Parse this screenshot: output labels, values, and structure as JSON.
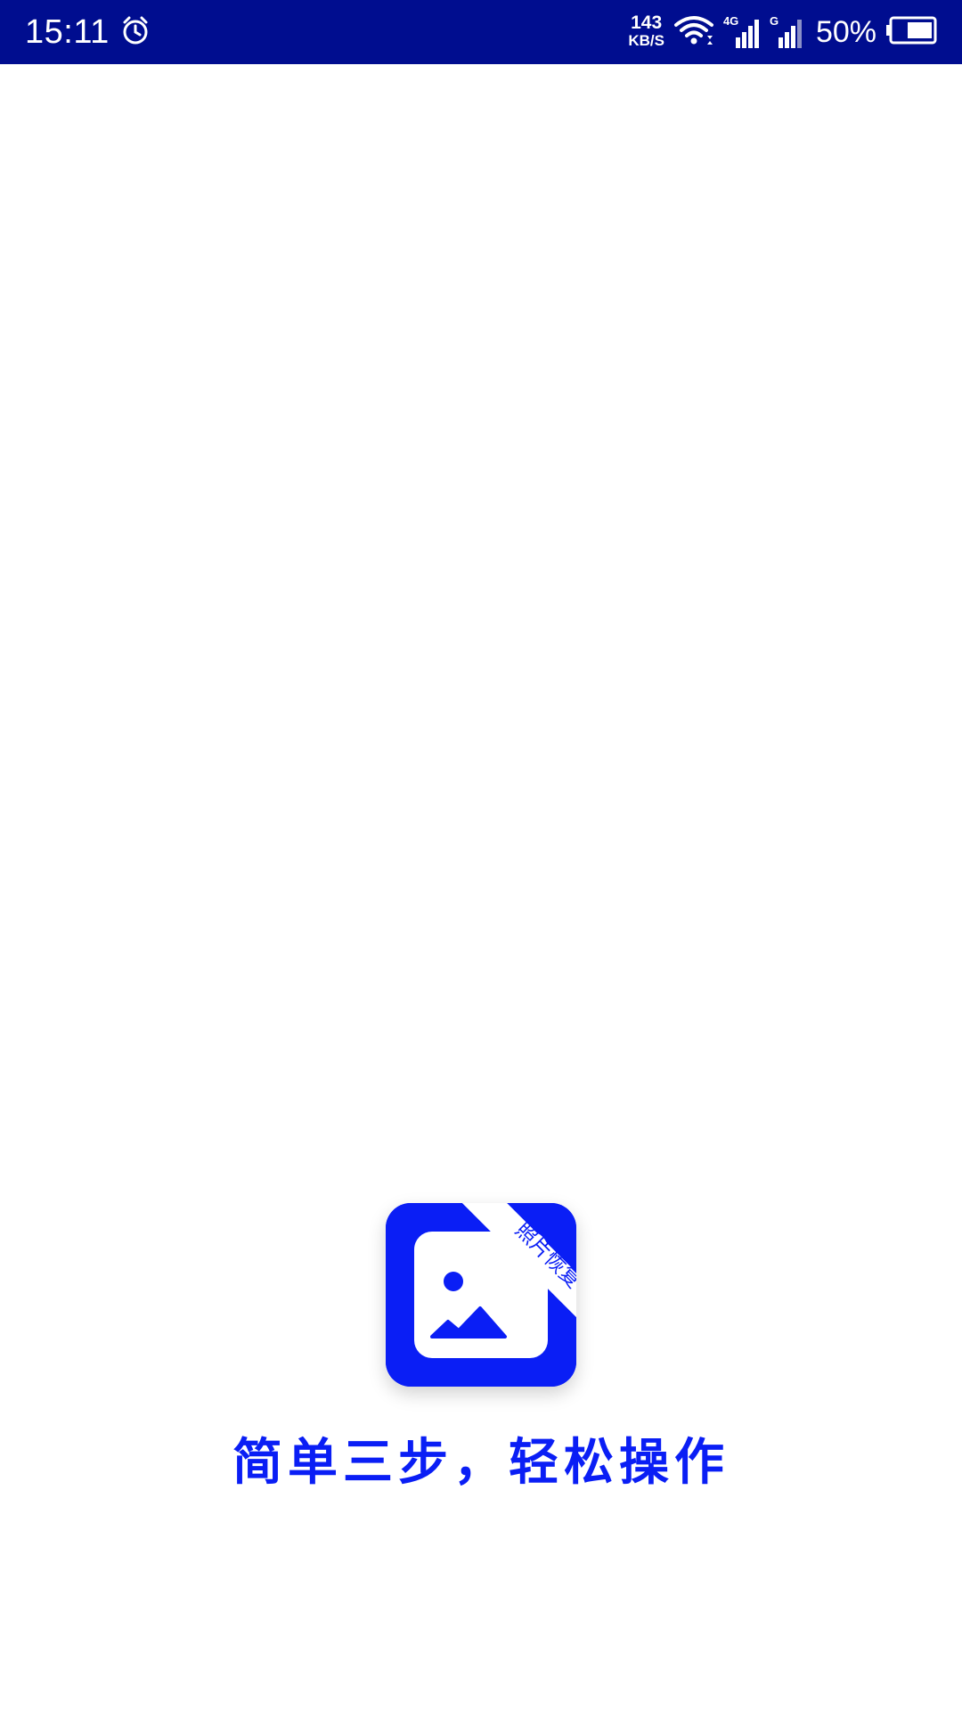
{
  "status_bar": {
    "time": "15:11",
    "net_speed_value": "143",
    "net_speed_unit": "KB/S",
    "sim1_label": "4G",
    "sim2_label": "G",
    "battery_percent": "50%",
    "background_color": "#000d8f",
    "icons": [
      "alarm-icon",
      "wifi-icon",
      "signal-icon",
      "signal-icon",
      "battery-icon"
    ]
  },
  "splash": {
    "logo_ribbon_text": "照片恢复",
    "slogan": "简单三步，轻松操作",
    "brand_color": "#0a1ef5"
  }
}
